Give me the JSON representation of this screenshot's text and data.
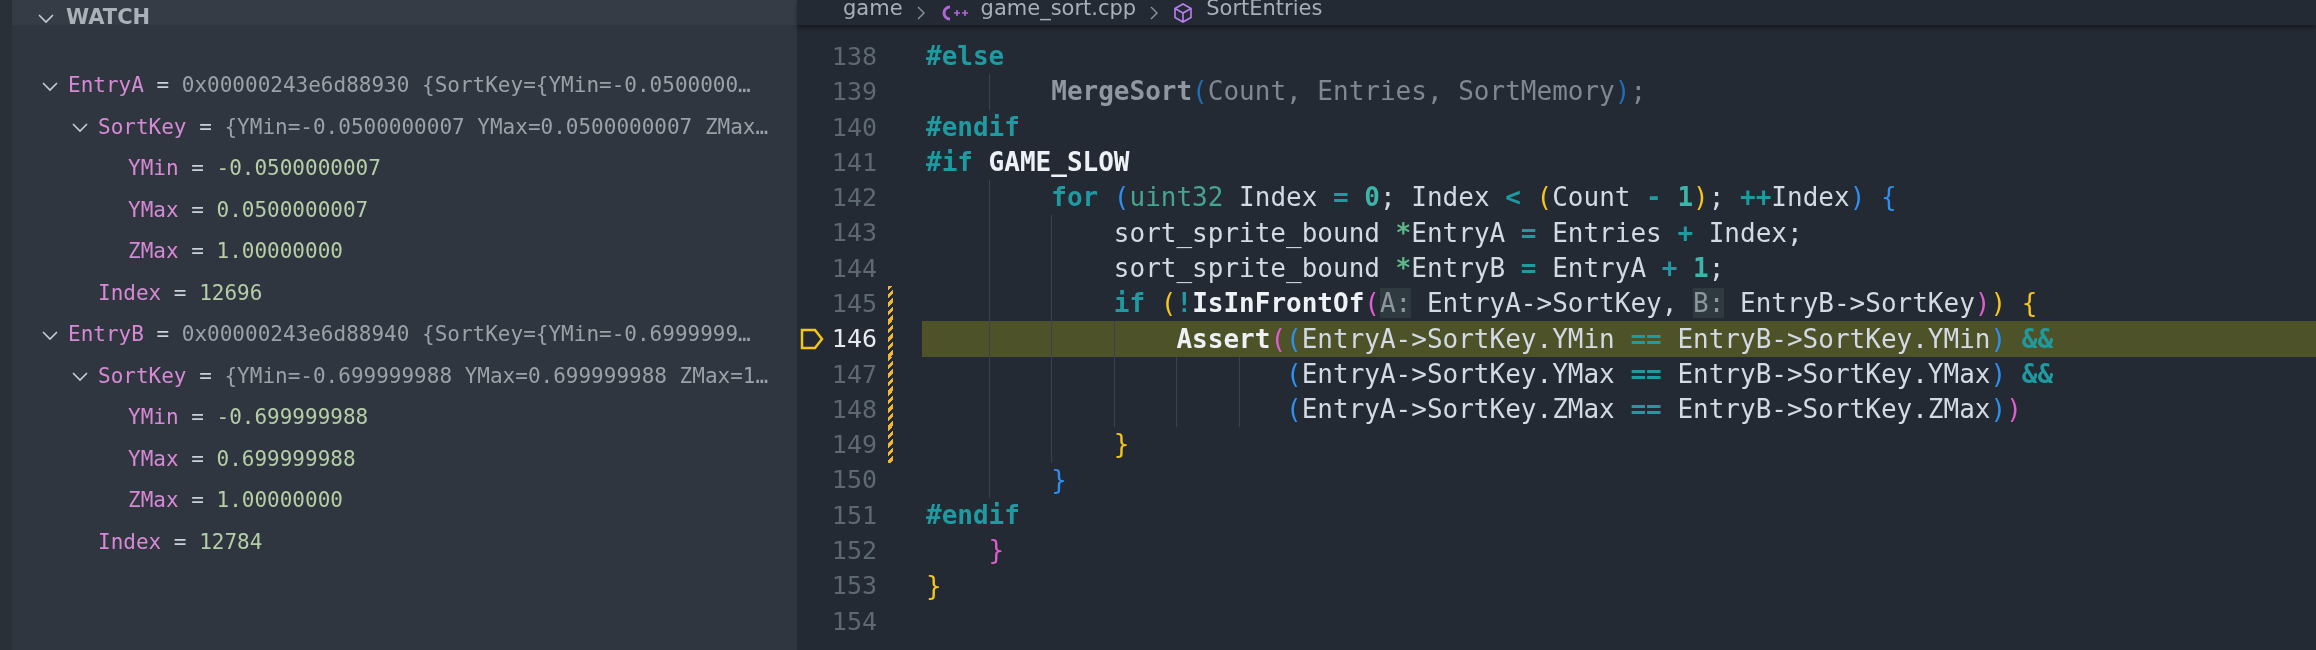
{
  "watch": {
    "title": "WATCH",
    "expanded": true,
    "items": [
      {
        "name": "EntryA",
        "sep": "=",
        "value": "0x00000243e6d88930 {SortKey={YMin=-0.0500000…",
        "expanded": true,
        "children": [
          {
            "name": "SortKey",
            "sep": "=",
            "value": "{YMin=-0.0500000007 YMax=0.0500000007 ZMax…",
            "expanded": true,
            "children": [
              {
                "name": "YMin",
                "sep": "=",
                "value": "-0.0500000007"
              },
              {
                "name": "YMax",
                "sep": "=",
                "value": "0.0500000007"
              },
              {
                "name": "ZMax",
                "sep": "=",
                "value": "1.00000000"
              }
            ]
          },
          {
            "name": "Index",
            "sep": "=",
            "value": "12696"
          }
        ]
      },
      {
        "name": "EntryB",
        "sep": "=",
        "value": "0x00000243e6d88940 {SortKey={YMin=-0.6999999…",
        "expanded": true,
        "children": [
          {
            "name": "SortKey",
            "sep": "=",
            "value": "{YMin=-0.699999988 YMax=0.699999988 ZMax=1…",
            "expanded": true,
            "children": [
              {
                "name": "YMin",
                "sep": "=",
                "value": "-0.699999988"
              },
              {
                "name": "YMax",
                "sep": "=",
                "value": "0.699999988"
              },
              {
                "name": "ZMax",
                "sep": "=",
                "value": "1.00000000"
              }
            ]
          },
          {
            "name": "Index",
            "sep": "=",
            "value": "12784"
          }
        ]
      }
    ]
  },
  "breadcrumb": [
    {
      "label": "game",
      "kind": "folder"
    },
    {
      "label": "game_sort.cpp",
      "kind": "cpp"
    },
    {
      "label": "SortEntries",
      "kind": "symbol"
    }
  ],
  "editor": {
    "lines": [
      {
        "number": "138",
        "current": false,
        "modified": false,
        "tokens": [
          {
            "text": "#else",
            "kind": "preproc"
          }
        ]
      },
      {
        "number": "139",
        "current": false,
        "modified": false,
        "tokens": [
          {
            "text": "        MergeSort",
            "kind": "dimfunc"
          },
          {
            "text": "(",
            "kind": "bracket",
            "color": "#1d6fb8"
          },
          {
            "text": "Count, Entries, SortMemory",
            "kind": "dim"
          },
          {
            "text": ")",
            "kind": "bracket",
            "color": "#1d6fb8"
          },
          {
            "text": ";",
            "kind": "dim"
          }
        ]
      },
      {
        "number": "140",
        "current": false,
        "modified": false,
        "tokens": [
          {
            "text": "#endif",
            "kind": "preproc"
          }
        ]
      },
      {
        "number": "141",
        "current": false,
        "modified": false,
        "tokens": [
          {
            "text": "#if",
            "kind": "preproc"
          },
          {
            "text": " GAME_SLOW",
            "kind": "macro"
          }
        ]
      },
      {
        "number": "142",
        "current": false,
        "modified": false,
        "tokens": [
          {
            "text": "        for ",
            "kind": "keyword"
          },
          {
            "text": "(",
            "kind": "bracket",
            "color": "#2f8ff0"
          },
          {
            "text": "uint32",
            "kind": "type"
          },
          {
            "text": " Index ",
            "kind": "ident"
          },
          {
            "text": "= ",
            "kind": "op"
          },
          {
            "text": "0",
            "kind": "number"
          },
          {
            "text": "; Index ",
            "kind": "ident"
          },
          {
            "text": "< ",
            "kind": "op"
          },
          {
            "text": "(",
            "kind": "bracket",
            "color": "#f5c518"
          },
          {
            "text": "Count ",
            "kind": "ident"
          },
          {
            "text": "- ",
            "kind": "op"
          },
          {
            "text": "1",
            "kind": "number"
          },
          {
            "text": ")",
            "kind": "bracket",
            "color": "#f5c518"
          },
          {
            "text": "; ",
            "kind": "ident"
          },
          {
            "text": "++",
            "kind": "op"
          },
          {
            "text": "Index",
            "kind": "ident"
          },
          {
            "text": ")",
            "kind": "bracket",
            "color": "#2f8ff0"
          },
          {
            "text": " {",
            "kind": "bracket",
            "color": "#2f8ff0"
          }
        ]
      },
      {
        "number": "143",
        "current": false,
        "modified": false,
        "tokens": [
          {
            "text": "            sort_sprite_bound ",
            "kind": "ident"
          },
          {
            "text": "*",
            "kind": "ptr"
          },
          {
            "text": "EntryA ",
            "kind": "ident"
          },
          {
            "text": "=",
            "kind": "op"
          },
          {
            "text": " Entries ",
            "kind": "ident"
          },
          {
            "text": "+",
            "kind": "op"
          },
          {
            "text": " Index;",
            "kind": "ident"
          }
        ]
      },
      {
        "number": "144",
        "current": false,
        "modified": false,
        "tokens": [
          {
            "text": "            sort_sprite_bound ",
            "kind": "ident"
          },
          {
            "text": "*",
            "kind": "ptr"
          },
          {
            "text": "EntryB ",
            "kind": "ident"
          },
          {
            "text": "=",
            "kind": "op"
          },
          {
            "text": " EntryA ",
            "kind": "ident"
          },
          {
            "text": "+ ",
            "kind": "op"
          },
          {
            "text": "1",
            "kind": "number"
          },
          {
            "text": ";",
            "kind": "ident"
          }
        ]
      },
      {
        "number": "145",
        "current": false,
        "modified": true,
        "tokens": [
          {
            "text": "            if ",
            "kind": "keyword"
          },
          {
            "text": "(",
            "kind": "bracket",
            "color": "#f5c518"
          },
          {
            "text": "!",
            "kind": "op"
          },
          {
            "text": "IsInFrontOf",
            "kind": "func"
          },
          {
            "text": "(",
            "kind": "bracket",
            "color": "#e05ccf"
          },
          {
            "text": "A:",
            "kind": "hint"
          },
          {
            "text": " EntryA->SortKey, ",
            "kind": "ident"
          },
          {
            "text": "B:",
            "kind": "hint"
          },
          {
            "text": " EntryB->SortKey",
            "kind": "ident"
          },
          {
            "text": ")",
            "kind": "bracket",
            "color": "#e05ccf"
          },
          {
            "text": ")",
            "kind": "bracket",
            "color": "#f5c518"
          },
          {
            "text": " {",
            "kind": "bracket",
            "color": "#f5c518"
          }
        ]
      },
      {
        "number": "146",
        "current": true,
        "modified": true,
        "tokens": [
          {
            "text": "                Assert",
            "kind": "func"
          },
          {
            "text": "(",
            "kind": "bracket",
            "color": "#e05ccf"
          },
          {
            "text": "(",
            "kind": "bracket",
            "color": "#2f8ff0"
          },
          {
            "text": "EntryA->SortKey.YMin ",
            "kind": "ident"
          },
          {
            "text": "==",
            "kind": "op"
          },
          {
            "text": " EntryB->SortKey.YMin",
            "kind": "ident"
          },
          {
            "text": ")",
            "kind": "bracket",
            "color": "#2f8ff0"
          },
          {
            "text": " &&",
            "kind": "op"
          }
        ]
      },
      {
        "number": "147",
        "current": false,
        "modified": true,
        "tokens": [
          {
            "text": "                       (",
            "kind": "bracket",
            "color": "#2f8ff0"
          },
          {
            "text": "EntryA->SortKey.YMax ",
            "kind": "ident"
          },
          {
            "text": "==",
            "kind": "op"
          },
          {
            "text": " EntryB->SortKey.YMax",
            "kind": "ident"
          },
          {
            "text": ")",
            "kind": "bracket",
            "color": "#2f8ff0"
          },
          {
            "text": " &&",
            "kind": "op"
          }
        ]
      },
      {
        "number": "148",
        "current": false,
        "modified": true,
        "tokens": [
          {
            "text": "                       (",
            "kind": "bracket",
            "color": "#2f8ff0"
          },
          {
            "text": "EntryA->SortKey.ZMax ",
            "kind": "ident"
          },
          {
            "text": "==",
            "kind": "op"
          },
          {
            "text": " EntryB->SortKey.ZMax",
            "kind": "ident"
          },
          {
            "text": ")",
            "kind": "bracket",
            "color": "#2f8ff0"
          },
          {
            "text": ")",
            "kind": "bracket",
            "color": "#e05ccf"
          }
        ]
      },
      {
        "number": "149",
        "current": false,
        "modified": true,
        "tokens": [
          {
            "text": "            }",
            "kind": "bracket",
            "color": "#f5c518"
          }
        ]
      },
      {
        "number": "150",
        "current": false,
        "modified": false,
        "tokens": [
          {
            "text": "        }",
            "kind": "bracket",
            "color": "#2f8ff0"
          }
        ]
      },
      {
        "number": "151",
        "current": false,
        "modified": false,
        "tokens": [
          {
            "text": "#endif",
            "kind": "preproc"
          }
        ]
      },
      {
        "number": "152",
        "current": false,
        "modified": false,
        "tokens": [
          {
            "text": "    }",
            "kind": "bracket",
            "color": "#e05ccf"
          }
        ]
      },
      {
        "number": "153",
        "current": false,
        "modified": false,
        "tokens": [
          {
            "text": "}",
            "kind": "bracket",
            "color": "#f5c518"
          }
        ]
      },
      {
        "number": "154",
        "current": false,
        "modified": false
      }
    ]
  }
}
